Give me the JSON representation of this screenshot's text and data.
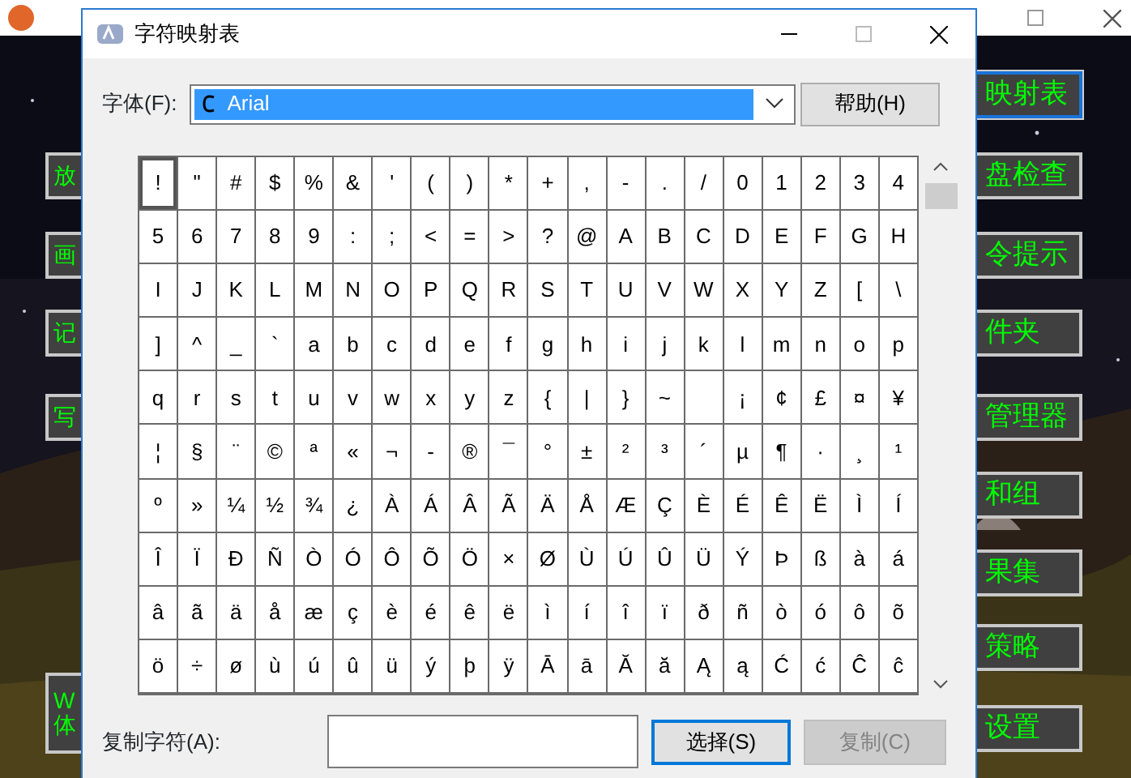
{
  "back_window": {
    "left_buttons": [
      {
        "lines": [
          "放"
        ]
      },
      {
        "lines": [
          "画"
        ]
      },
      {
        "lines": [
          "记"
        ]
      },
      {
        "lines": [
          "写"
        ]
      },
      {
        "lines": [
          "W",
          "体"
        ]
      }
    ],
    "right_buttons": [
      {
        "label": "映射表",
        "focused": true
      },
      {
        "label": "盘检查",
        "focused": false
      },
      {
        "label": "令提示",
        "focused": false
      },
      {
        "label": "件夹",
        "focused": false
      },
      {
        "label": "管理器",
        "focused": false
      },
      {
        "label": "和组",
        "focused": false
      },
      {
        "label": "果集",
        "focused": false
      },
      {
        "label": "策略",
        "focused": false
      },
      {
        "label": "设置",
        "focused": false
      }
    ]
  },
  "dialog": {
    "title": "字符映射表",
    "font_label": "字体(F):",
    "font_value": "Arial",
    "help_button": "帮助(H)",
    "characters": [
      [
        {
          "c": "!",
          "selected": true
        },
        {
          "c": "\"",
          "selected": false
        },
        {
          "c": "#",
          "selected": false
        },
        {
          "c": "$",
          "selected": false
        },
        {
          "c": "%",
          "selected": false
        },
        {
          "c": "&",
          "selected": false
        },
        {
          "c": "'",
          "selected": false
        },
        {
          "c": "(",
          "selected": false
        },
        {
          "c": ")",
          "selected": false
        },
        {
          "c": "*",
          "selected": false
        },
        {
          "c": "+",
          "selected": false
        },
        {
          "c": ",",
          "selected": false
        },
        {
          "c": "-",
          "selected": false
        },
        {
          "c": ".",
          "selected": false
        },
        {
          "c": "/",
          "selected": false
        },
        {
          "c": "0",
          "selected": false
        },
        {
          "c": "1",
          "selected": false
        },
        {
          "c": "2",
          "selected": false
        },
        {
          "c": "3",
          "selected": false
        },
        {
          "c": "4",
          "selected": false
        }
      ],
      [
        {
          "c": "5",
          "selected": false
        },
        {
          "c": "6",
          "selected": false
        },
        {
          "c": "7",
          "selected": false
        },
        {
          "c": "8",
          "selected": false
        },
        {
          "c": "9",
          "selected": false
        },
        {
          "c": ":",
          "selected": false
        },
        {
          "c": ";",
          "selected": false
        },
        {
          "c": "<",
          "selected": false
        },
        {
          "c": "=",
          "selected": false
        },
        {
          "c": ">",
          "selected": false
        },
        {
          "c": "?",
          "selected": false
        },
        {
          "c": "@",
          "selected": false
        },
        {
          "c": "A",
          "selected": false
        },
        {
          "c": "B",
          "selected": false
        },
        {
          "c": "C",
          "selected": false
        },
        {
          "c": "D",
          "selected": false
        },
        {
          "c": "E",
          "selected": false
        },
        {
          "c": "F",
          "selected": false
        },
        {
          "c": "G",
          "selected": false
        },
        {
          "c": "H",
          "selected": false
        }
      ],
      [
        {
          "c": "I",
          "selected": false
        },
        {
          "c": "J",
          "selected": false
        },
        {
          "c": "K",
          "selected": false
        },
        {
          "c": "L",
          "selected": false
        },
        {
          "c": "M",
          "selected": false
        },
        {
          "c": "N",
          "selected": false
        },
        {
          "c": "O",
          "selected": false
        },
        {
          "c": "P",
          "selected": false
        },
        {
          "c": "Q",
          "selected": false
        },
        {
          "c": "R",
          "selected": false
        },
        {
          "c": "S",
          "selected": false
        },
        {
          "c": "T",
          "selected": false
        },
        {
          "c": "U",
          "selected": false
        },
        {
          "c": "V",
          "selected": false
        },
        {
          "c": "W",
          "selected": false
        },
        {
          "c": "X",
          "selected": false
        },
        {
          "c": "Y",
          "selected": false
        },
        {
          "c": "Z",
          "selected": false
        },
        {
          "c": "[",
          "selected": false
        },
        {
          "c": "\\",
          "selected": false
        }
      ],
      [
        {
          "c": "]",
          "selected": false
        },
        {
          "c": "^",
          "selected": false
        },
        {
          "c": "_",
          "selected": false
        },
        {
          "c": "`",
          "selected": false
        },
        {
          "c": "a",
          "selected": false
        },
        {
          "c": "b",
          "selected": false
        },
        {
          "c": "c",
          "selected": false
        },
        {
          "c": "d",
          "selected": false
        },
        {
          "c": "e",
          "selected": false
        },
        {
          "c": "f",
          "selected": false
        },
        {
          "c": "g",
          "selected": false
        },
        {
          "c": "h",
          "selected": false
        },
        {
          "c": "i",
          "selected": false
        },
        {
          "c": "j",
          "selected": false
        },
        {
          "c": "k",
          "selected": false
        },
        {
          "c": "l",
          "selected": false
        },
        {
          "c": "m",
          "selected": false
        },
        {
          "c": "n",
          "selected": false
        },
        {
          "c": "o",
          "selected": false
        },
        {
          "c": "p",
          "selected": false
        }
      ],
      [
        {
          "c": "q",
          "selected": false
        },
        {
          "c": "r",
          "selected": false
        },
        {
          "c": "s",
          "selected": false
        },
        {
          "c": "t",
          "selected": false
        },
        {
          "c": "u",
          "selected": false
        },
        {
          "c": "v",
          "selected": false
        },
        {
          "c": "w",
          "selected": false
        },
        {
          "c": "x",
          "selected": false
        },
        {
          "c": "y",
          "selected": false
        },
        {
          "c": "z",
          "selected": false
        },
        {
          "c": "{",
          "selected": false
        },
        {
          "c": "|",
          "selected": false
        },
        {
          "c": "}",
          "selected": false
        },
        {
          "c": "~",
          "selected": false
        },
        {
          "selected": false
        },
        {
          "c": "¡",
          "selected": false
        },
        {
          "c": "¢",
          "selected": false
        },
        {
          "c": "£",
          "selected": false
        },
        {
          "c": "¤",
          "selected": false
        },
        {
          "c": "¥",
          "selected": false
        }
      ],
      [
        {
          "c": "¦",
          "selected": false
        },
        {
          "c": "§",
          "selected": false
        },
        {
          "c": "¨",
          "selected": false
        },
        {
          "c": "©",
          "selected": false
        },
        {
          "c": "ª",
          "selected": false
        },
        {
          "c": "«",
          "selected": false
        },
        {
          "c": "¬",
          "selected": false
        },
        {
          "c": "-",
          "selected": false
        },
        {
          "c": "®",
          "selected": false
        },
        {
          "c": "¯",
          "selected": false
        },
        {
          "c": "°",
          "selected": false
        },
        {
          "c": "±",
          "selected": false
        },
        {
          "c": "²",
          "selected": false
        },
        {
          "c": "³",
          "selected": false
        },
        {
          "c": "´",
          "selected": false
        },
        {
          "c": "µ",
          "selected": false
        },
        {
          "c": "¶",
          "selected": false
        },
        {
          "c": "·",
          "selected": false
        },
        {
          "c": "¸",
          "selected": false
        },
        {
          "c": "¹",
          "selected": false
        }
      ],
      [
        {
          "c": "º",
          "selected": false
        },
        {
          "c": "»",
          "selected": false
        },
        {
          "c": "¼",
          "selected": false
        },
        {
          "c": "½",
          "selected": false
        },
        {
          "c": "¾",
          "selected": false
        },
        {
          "c": "¿",
          "selected": false
        },
        {
          "c": "À",
          "selected": false
        },
        {
          "c": "Á",
          "selected": false
        },
        {
          "c": "Â",
          "selected": false
        },
        {
          "c": "Ã",
          "selected": false
        },
        {
          "c": "Ä",
          "selected": false
        },
        {
          "c": "Å",
          "selected": false
        },
        {
          "c": "Æ",
          "selected": false
        },
        {
          "c": "Ç",
          "selected": false
        },
        {
          "c": "È",
          "selected": false
        },
        {
          "c": "É",
          "selected": false
        },
        {
          "c": "Ê",
          "selected": false
        },
        {
          "c": "Ë",
          "selected": false
        },
        {
          "c": "Ì",
          "selected": false
        },
        {
          "c": "Í",
          "selected": false
        }
      ],
      [
        {
          "c": "Î",
          "selected": false
        },
        {
          "c": "Ï",
          "selected": false
        },
        {
          "c": "Ð",
          "selected": false
        },
        {
          "c": "Ñ",
          "selected": false
        },
        {
          "c": "Ò",
          "selected": false
        },
        {
          "c": "Ó",
          "selected": false
        },
        {
          "c": "Ô",
          "selected": false
        },
        {
          "c": "Õ",
          "selected": false
        },
        {
          "c": "Ö",
          "selected": false
        },
        {
          "c": "×",
          "selected": false
        },
        {
          "c": "Ø",
          "selected": false
        },
        {
          "c": "Ù",
          "selected": false
        },
        {
          "c": "Ú",
          "selected": false
        },
        {
          "c": "Û",
          "selected": false
        },
        {
          "c": "Ü",
          "selected": false
        },
        {
          "c": "Ý",
          "selected": false
        },
        {
          "c": "Þ",
          "selected": false
        },
        {
          "c": "ß",
          "selected": false
        },
        {
          "c": "à",
          "selected": false
        },
        {
          "c": "á",
          "selected": false
        }
      ],
      [
        {
          "c": "â",
          "selected": false
        },
        {
          "c": "ã",
          "selected": false
        },
        {
          "c": "ä",
          "selected": false
        },
        {
          "c": "å",
          "selected": false
        },
        {
          "c": "æ",
          "selected": false
        },
        {
          "c": "ç",
          "selected": false
        },
        {
          "c": "è",
          "selected": false
        },
        {
          "c": "é",
          "selected": false
        },
        {
          "c": "ê",
          "selected": false
        },
        {
          "c": "ë",
          "selected": false
        },
        {
          "c": "ì",
          "selected": false
        },
        {
          "c": "í",
          "selected": false
        },
        {
          "c": "î",
          "selected": false
        },
        {
          "c": "ï",
          "selected": false
        },
        {
          "c": "ð",
          "selected": false
        },
        {
          "c": "ñ",
          "selected": false
        },
        {
          "c": "ò",
          "selected": false
        },
        {
          "c": "ó",
          "selected": false
        },
        {
          "c": "ô",
          "selected": false
        },
        {
          "c": "õ",
          "selected": false
        }
      ],
      [
        {
          "c": "ö",
          "selected": false
        },
        {
          "c": "÷",
          "selected": false
        },
        {
          "c": "ø",
          "selected": false
        },
        {
          "c": "ù",
          "selected": false
        },
        {
          "c": "ú",
          "selected": false
        },
        {
          "c": "û",
          "selected": false
        },
        {
          "c": "ü",
          "selected": false
        },
        {
          "c": "ý",
          "selected": false
        },
        {
          "c": "þ",
          "selected": false
        },
        {
          "c": "ÿ",
          "selected": false
        },
        {
          "c": "Ā",
          "selected": false
        },
        {
          "c": "ā",
          "selected": false
        },
        {
          "c": "Ă",
          "selected": false
        },
        {
          "c": "ă",
          "selected": false
        },
        {
          "c": "Ą",
          "selected": false
        },
        {
          "c": "ą",
          "selected": false
        },
        {
          "c": "Ć",
          "selected": false
        },
        {
          "c": "ć",
          "selected": false
        },
        {
          "c": "Ĉ",
          "selected": false
        },
        {
          "c": "ĉ",
          "selected": false
        }
      ]
    ],
    "copy_label": "复制字符(A):",
    "select_button": {
      "label": "选择(S)",
      "focused": true
    },
    "copy_button": {
      "label": "复制(C)",
      "disabled": true
    }
  }
}
